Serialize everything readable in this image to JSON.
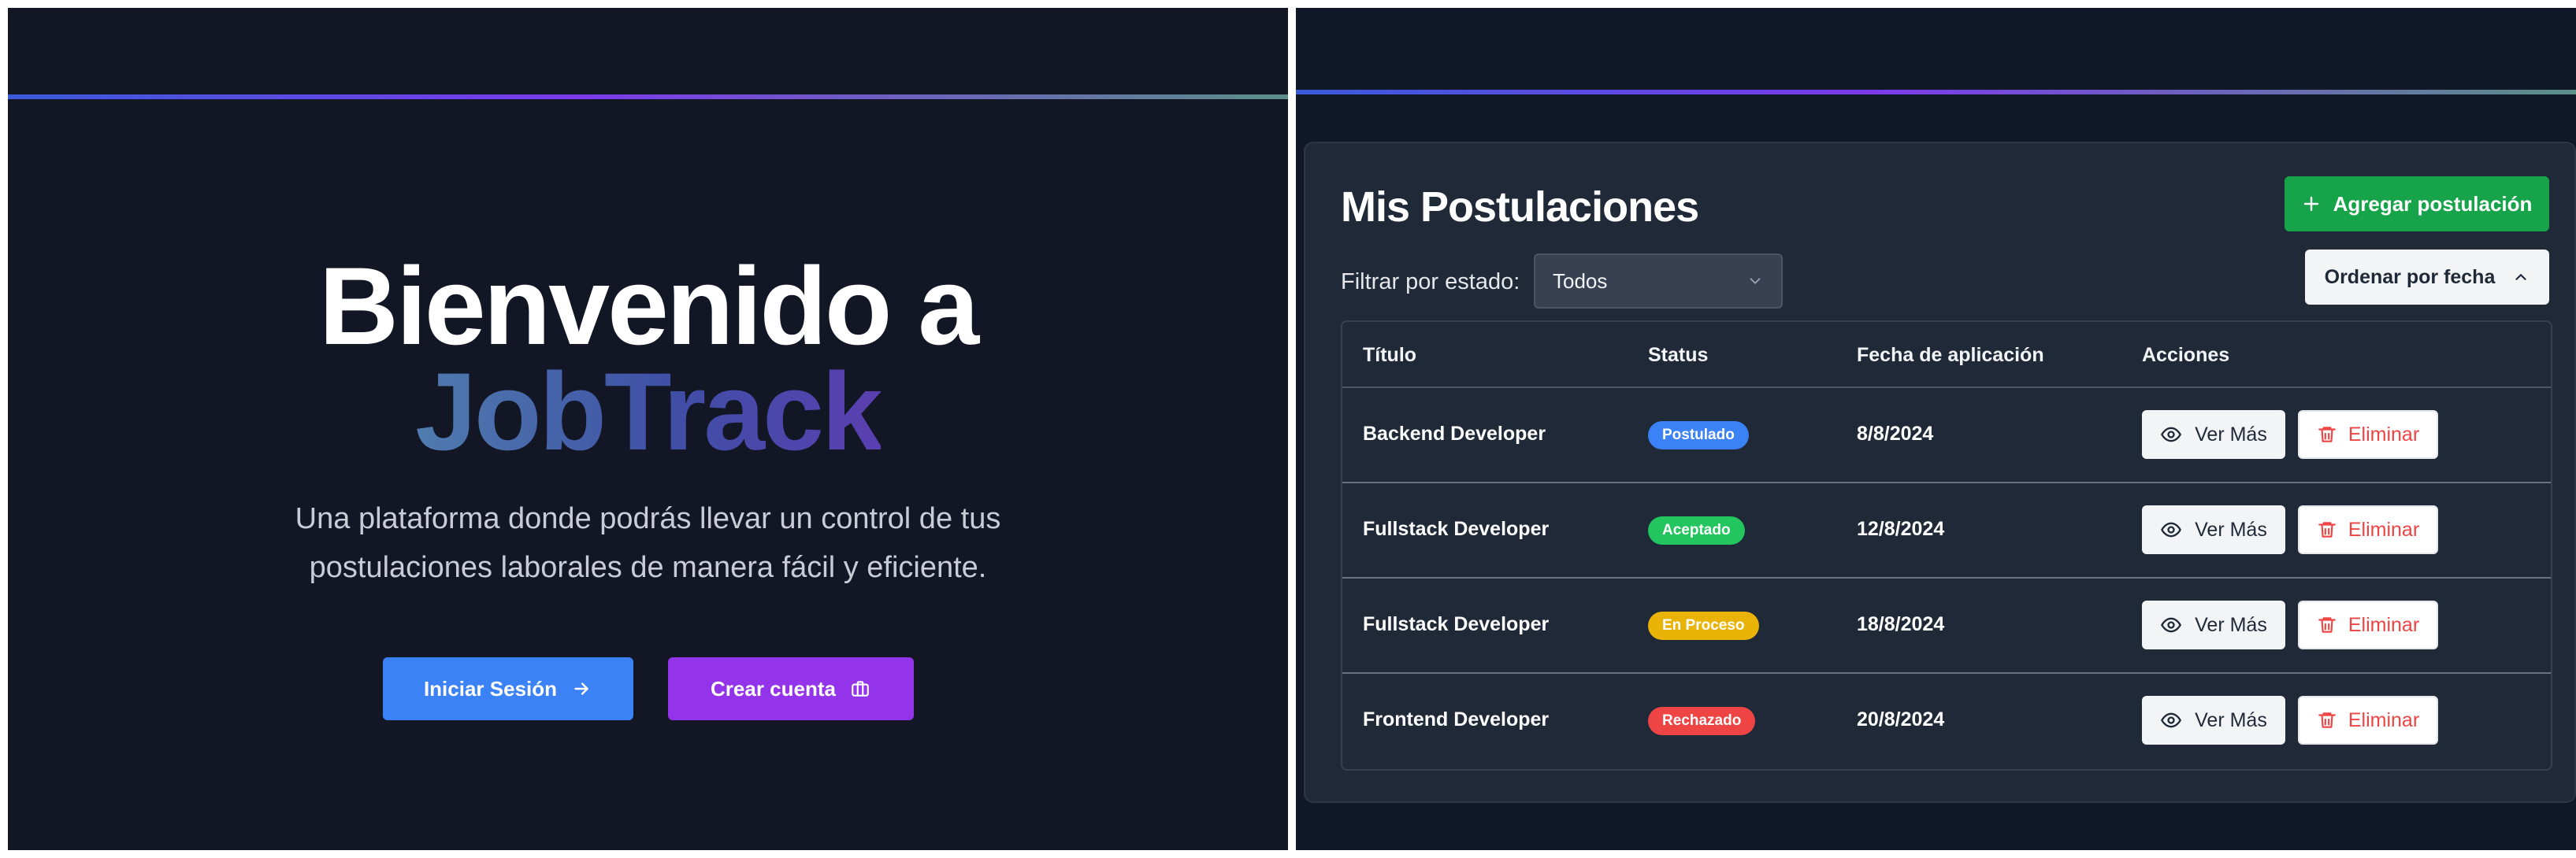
{
  "landing": {
    "title_line1": "Bienvenido a",
    "brand": "JobTrack",
    "description_line1": "Una plataforma donde podrás llevar un control de tus",
    "description_line2": "postulaciones laborales de manera fácil y eficiente.",
    "login_label": "Iniciar Sesión",
    "signup_label": "Crear cuenta",
    "colors": {
      "login": "#3b82f6",
      "signup": "#9333ea",
      "background": "#121625"
    }
  },
  "dashboard": {
    "title": "Mis Postulaciones",
    "add_label": "Agregar postulación",
    "filter_label": "Filtrar por estado:",
    "filter_value": "Todos",
    "sort_label": "Ordenar por fecha",
    "columns": [
      "Título",
      "Status",
      "Fecha de aplicación",
      "Acciones"
    ],
    "view_label": "Ver Más",
    "delete_label": "Eliminar",
    "rows": [
      {
        "title": "Backend Developer",
        "status": "Postulado",
        "status_color": "#3b82f6",
        "date": "8/8/2024"
      },
      {
        "title": "Fullstack Developer",
        "status": "Aceptado",
        "status_color": "#22c55e",
        "date": "12/8/2024"
      },
      {
        "title": "Fullstack Developer",
        "status": "En Proceso",
        "status_color": "#eab308",
        "date": "18/8/2024"
      },
      {
        "title": "Frontend Developer",
        "status": "Rechazado",
        "status_color": "#ef4444",
        "date": "20/8/2024"
      }
    ],
    "icons": {
      "add": "plus-icon",
      "sort": "chevron-up-icon",
      "select": "chevron-down-icon",
      "view": "eye-icon",
      "delete": "trash-icon"
    }
  }
}
